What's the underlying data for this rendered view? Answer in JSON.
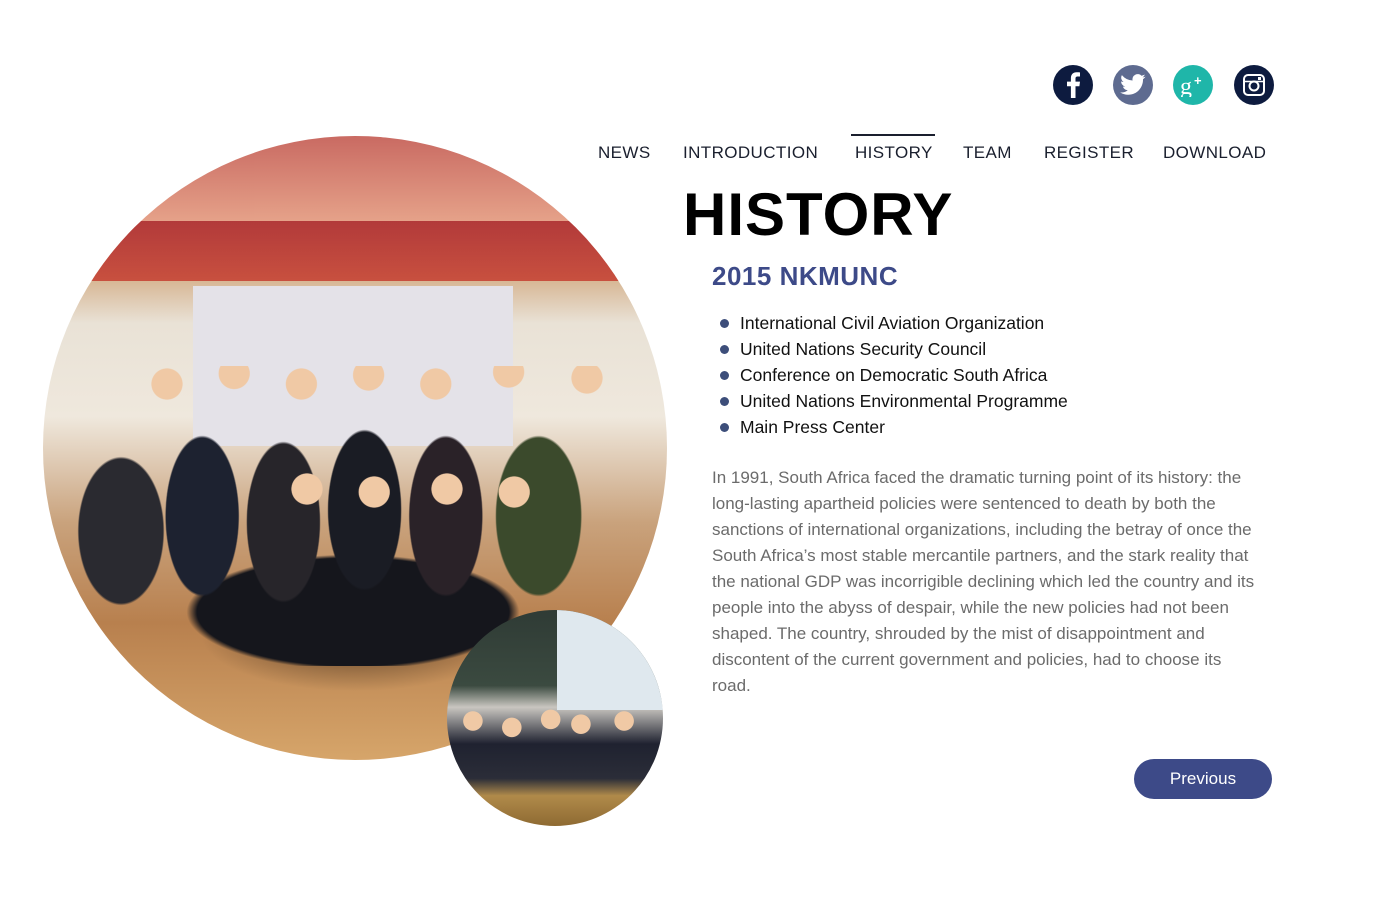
{
  "social": {
    "facebook": {
      "icon": "facebook-icon",
      "color": "#0d1b3f"
    },
    "twitter": {
      "icon": "twitter-icon",
      "color": "#5e6b90"
    },
    "googleplus": {
      "icon": "google-plus-icon",
      "color": "#1fb6a9"
    },
    "instagram": {
      "icon": "instagram-icon",
      "color": "#0d1b3f"
    }
  },
  "nav": {
    "items": [
      {
        "label": "NEWS"
      },
      {
        "label": "INTRODUCTION"
      },
      {
        "label": "HISTORY",
        "active": true
      },
      {
        "label": "TEAM"
      },
      {
        "label": "REGISTER"
      },
      {
        "label": "DOWNLOAD"
      }
    ]
  },
  "page": {
    "title": "HISTORY",
    "subtitle": "2015 NKMUNC",
    "committees": [
      "International Civil Aviation Organization",
      "United Nations Security Council",
      "Conference on Democratic South Africa",
      "United Nations Environmental Programme",
      "Main Press Center"
    ],
    "description": "In 1991, South Africa faced the dramatic turning point of its history: the long-lasting apartheid policies were sentenced to death by both the sanctions of international organizations, including the betray of once the South Africa’s most stable mercantile partners, and the stark reality that the national GDP was incorrigible declining which led the country and its people into the abyss of despair, while the new policies had not been shaped. The country, shrouded by the mist of disappointment and discontent of the current government and policies, had to choose its road.",
    "previous_label": "Previous"
  },
  "colors": {
    "accent": "#3d4a88",
    "bullet": "#3d4e7a",
    "body_text": "#6b6b6b"
  }
}
